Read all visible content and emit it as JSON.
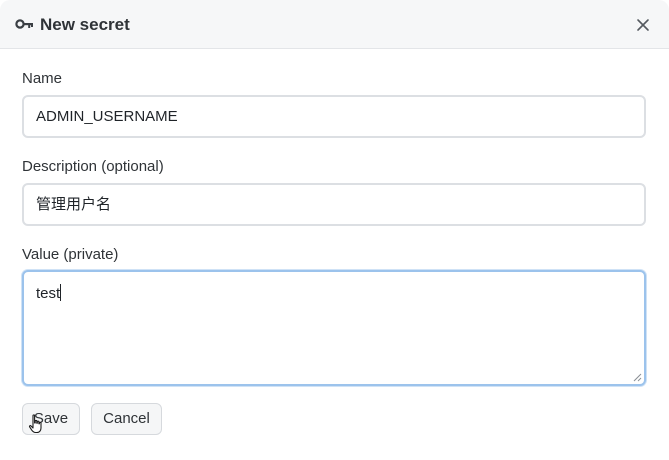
{
  "dialog": {
    "title": "New secret",
    "title_icon": "key-icon",
    "close_icon": "close-icon"
  },
  "form": {
    "name_label": "Name",
    "name_value": "ADMIN_USERNAME",
    "description_label": "Description (optional)",
    "description_value": "管理用户名",
    "value_label": "Value (private)",
    "value_value": "test"
  },
  "actions": {
    "save_label": "Save",
    "cancel_label": "Cancel"
  },
  "colors": {
    "header_bg": "#f6f7f8",
    "focus_border": "#9cc3ec"
  }
}
